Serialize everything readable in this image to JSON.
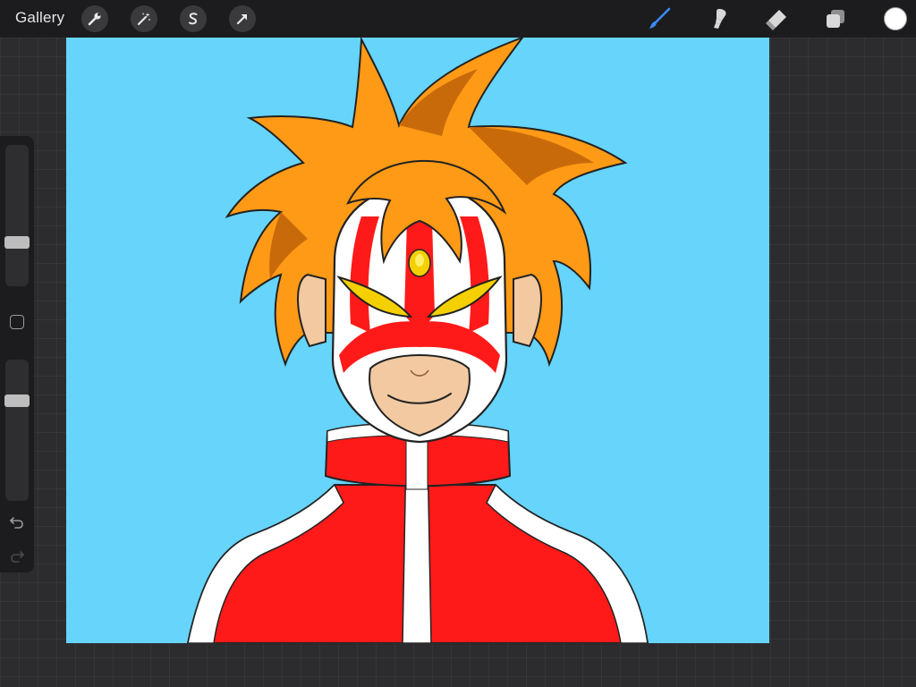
{
  "toolbar": {
    "gallery_label": "Gallery",
    "left_tools": [
      {
        "icon": "wrench-icon",
        "name": "actions"
      },
      {
        "icon": "magic-wand-icon",
        "name": "adjustments"
      },
      {
        "icon": "selection-s-icon",
        "name": "selection"
      },
      {
        "icon": "arrow-cursor-icon",
        "name": "transform"
      }
    ],
    "right_tools": [
      {
        "icon": "brush-icon",
        "name": "paint",
        "active": true
      },
      {
        "icon": "smudge-icon",
        "name": "smudge",
        "active": false
      },
      {
        "icon": "eraser-icon",
        "name": "erase",
        "active": false
      },
      {
        "icon": "layers-icon",
        "name": "layers",
        "active": false
      }
    ],
    "current_color": "#ffffff",
    "active_color": "#3a8bff"
  },
  "sidebar": {
    "brush_size_level": 0.29,
    "opacity_level": 0.73
  },
  "canvas": {
    "background_color": "#66d4fb"
  }
}
